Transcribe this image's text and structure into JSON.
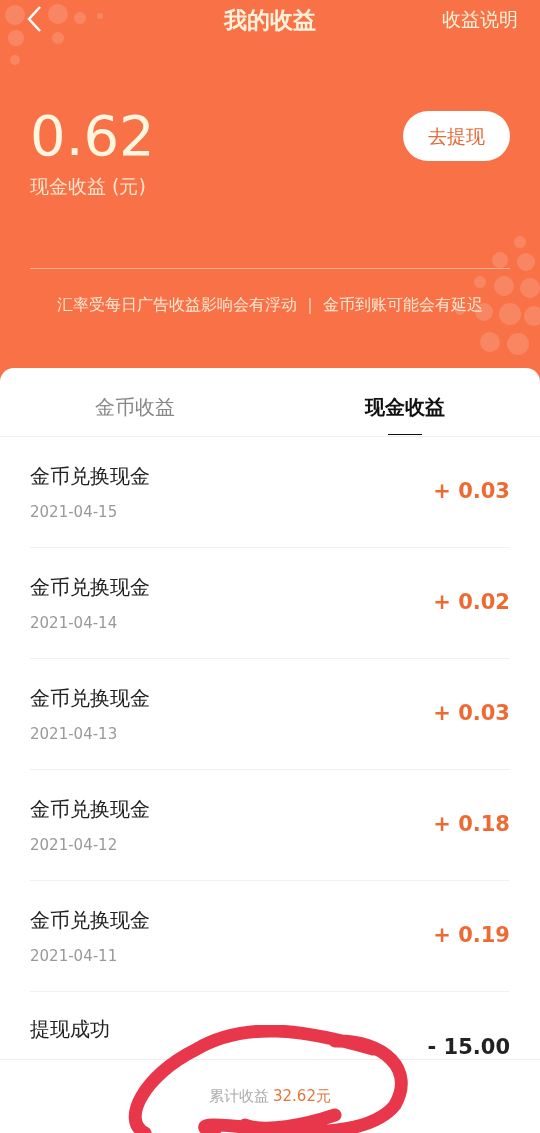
{
  "header": {
    "title": "我的收益",
    "help_link": "收益说明"
  },
  "balance": {
    "amount": "0.62",
    "label": "现金收益 (元)",
    "withdraw_button": "去提现"
  },
  "notice": "汇率受每日广告收益影响会有浮动 ｜ 金币到账可能会有延迟",
  "tabs": [
    {
      "label": "金币收益",
      "selected": false
    },
    {
      "label": "现金收益",
      "selected": true
    }
  ],
  "records": [
    {
      "title": "金币兑换现金",
      "date": "2021-04-15",
      "amount": "+ 0.03",
      "kind": "credit"
    },
    {
      "title": "金币兑换现金",
      "date": "2021-04-14",
      "amount": "+ 0.02",
      "kind": "credit"
    },
    {
      "title": "金币兑换现金",
      "date": "2021-04-13",
      "amount": "+ 0.03",
      "kind": "credit"
    },
    {
      "title": "金币兑换现金",
      "date": "2021-04-12",
      "amount": "+ 0.18",
      "kind": "credit"
    },
    {
      "title": "金币兑换现金",
      "date": "2021-04-11",
      "amount": "+ 0.19",
      "kind": "credit"
    },
    {
      "title": "提现成功",
      "amount": "- 15.00",
      "kind": "debit"
    }
  ],
  "footer": {
    "label": "累计收益",
    "amount": "32.62元"
  }
}
